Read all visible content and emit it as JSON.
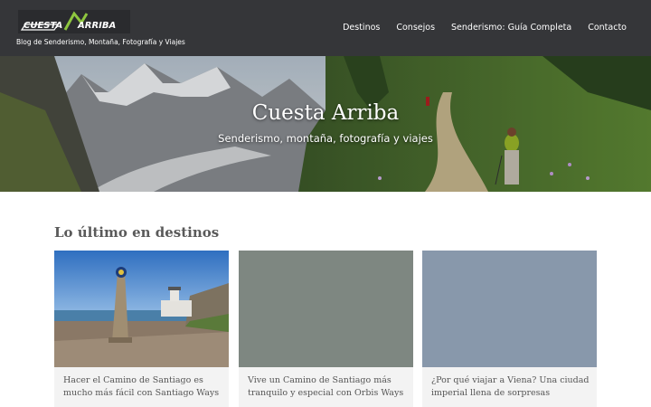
{
  "header": {
    "logo_text": "CUESTA ARRIBA",
    "tagline": "Blog de Senderismo, Montaña, Fotografía y Viajes",
    "nav": [
      {
        "label": "Destinos"
      },
      {
        "label": "Consejos"
      },
      {
        "label": "Senderismo: Guía Completa"
      },
      {
        "label": "Contacto"
      }
    ]
  },
  "hero": {
    "title": "Cuesta Arriba",
    "subtitle": "Senderismo, montaña, fotografía y viajes"
  },
  "section": {
    "title": "Lo último en destinos"
  },
  "cards": [
    {
      "caption": "Hacer el Camino de Santiago es mucho más fácil con Santiago Ways",
      "placeholder_color": ""
    },
    {
      "caption": "Vive un Camino de Santiago más tranquilo y especial con Orbis Ways",
      "placeholder_color": "#7e8781"
    },
    {
      "caption": "¿Por qué viajar a Viena? Una ciudad imperial llena de sorpresas",
      "placeholder_color": "#8898ab"
    }
  ],
  "colors": {
    "header_bg": "#353639",
    "logo_accent": "#8ec63f"
  }
}
